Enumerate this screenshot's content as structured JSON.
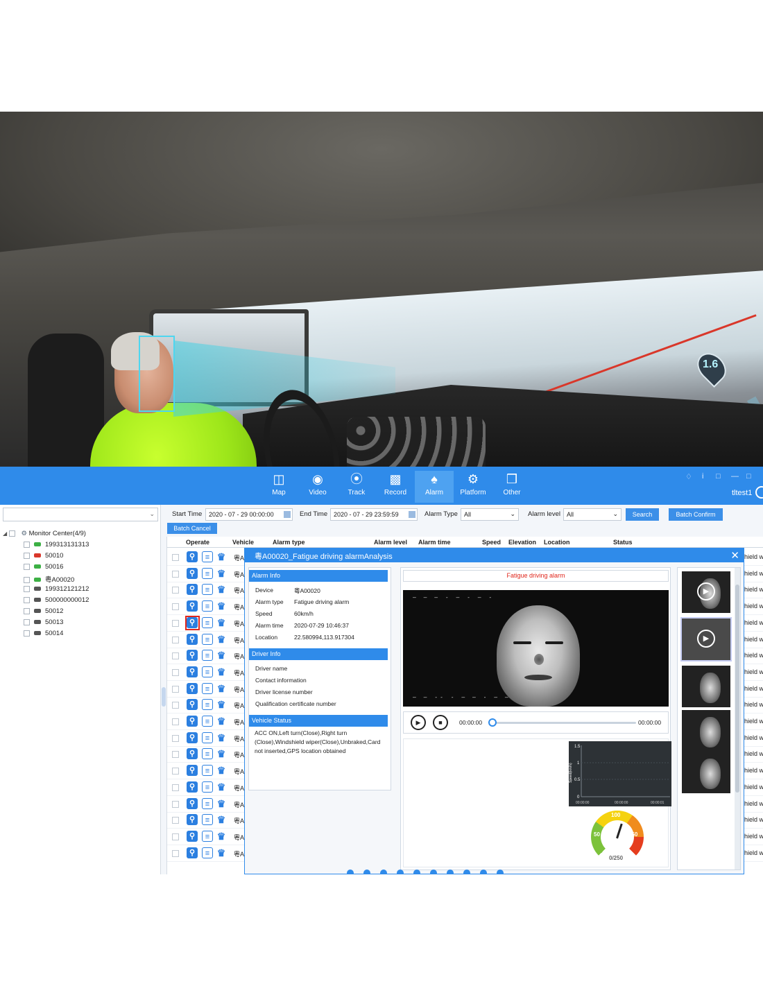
{
  "hero": {
    "distance_badge": "1.6"
  },
  "nav": {
    "items": [
      {
        "label": "Map",
        "icon": "monitor-eye-icon"
      },
      {
        "label": "Video",
        "icon": "webcam-icon"
      },
      {
        "label": "Track",
        "icon": "route-pin-icon"
      },
      {
        "label": "Record",
        "icon": "film-icon"
      },
      {
        "label": "Alarm",
        "icon": "alarm-bell-icon"
      },
      {
        "label": "Platform",
        "icon": "gear-icon"
      },
      {
        "label": "Other",
        "icon": "cube-icon"
      }
    ],
    "active": "Alarm",
    "user": "tltest1",
    "accent": "#2f8bea"
  },
  "tree": {
    "root": "Monitor Center(4/9)",
    "items": [
      {
        "label": "199313131313",
        "status": "#3cb044"
      },
      {
        "label": "50010",
        "status": "#d9372a"
      },
      {
        "label": "50016",
        "status": "#3cb044"
      },
      {
        "label": "粵A00020",
        "status": "#3cb044"
      },
      {
        "label": "199312121212",
        "status": "#555555"
      },
      {
        "label": "500000000012",
        "status": "#555555"
      },
      {
        "label": "50012",
        "status": "#555555"
      },
      {
        "label": "50013",
        "status": "#555555"
      },
      {
        "label": "50014",
        "status": "#555555"
      }
    ]
  },
  "filters": {
    "start_label": "Start Time",
    "start_value": "2020 - 07 - 29 00:00:00",
    "end_label": "End Time",
    "end_value": "2020 - 07 - 29 23:59:59",
    "type_label": "Alarm Type",
    "type_value": "All",
    "level_label": "Alarm level",
    "level_value": "All",
    "search": "Search",
    "batch_confirm": "Batch Confirm",
    "batch_cancel": "Batch Cancel"
  },
  "table": {
    "headers": [
      "Operate",
      "Vehicle",
      "Alarm type",
      "Alarm level",
      "Alarm time",
      "Speed",
      "Elevation",
      "Location",
      "Status"
    ],
    "row_vehicle": "粵A",
    "row_status": "hield w"
  },
  "dialog": {
    "title": "粵A00020_Fatigue driving alarmAnalysis",
    "alarm_info": {
      "title": "Alarm Info",
      "rows": [
        {
          "k": "Device",
          "v": "粵A00020"
        },
        {
          "k": "Alarm type",
          "v": "Fatigue driving alarm"
        },
        {
          "k": "Speed",
          "v": "60km/h"
        },
        {
          "k": "Alarm time",
          "v": "2020-07-29 10:46:37"
        },
        {
          "k": "Location",
          "v": "22.580994,113.917304"
        }
      ]
    },
    "driver_info": {
      "title": "Driver Info",
      "rows": [
        "Driver name",
        "Contact information",
        "Driver license number",
        "Qualification certificate number"
      ]
    },
    "vehicle_status": {
      "title": "Vehicle Status",
      "text": "ACC ON,Left turn(Close),Right turn (Close),Windshield wiper(Close),Unbraked,Card not inserted,GPS location obtained"
    },
    "video_title": "Fatigue driving alarm",
    "time_start": "00:00:00",
    "time_end": "00:00:00",
    "speed_chart": {
      "ylabel": "Speed(km/h)",
      "y_ticks": [
        "1.5",
        "1",
        "0.5",
        "0"
      ],
      "x_ticks": [
        "00:00:00",
        "00:00:00",
        "00:00:01"
      ]
    },
    "gauge": {
      "labels": [
        "100",
        "50",
        "150"
      ],
      "readout": "0/250"
    }
  }
}
